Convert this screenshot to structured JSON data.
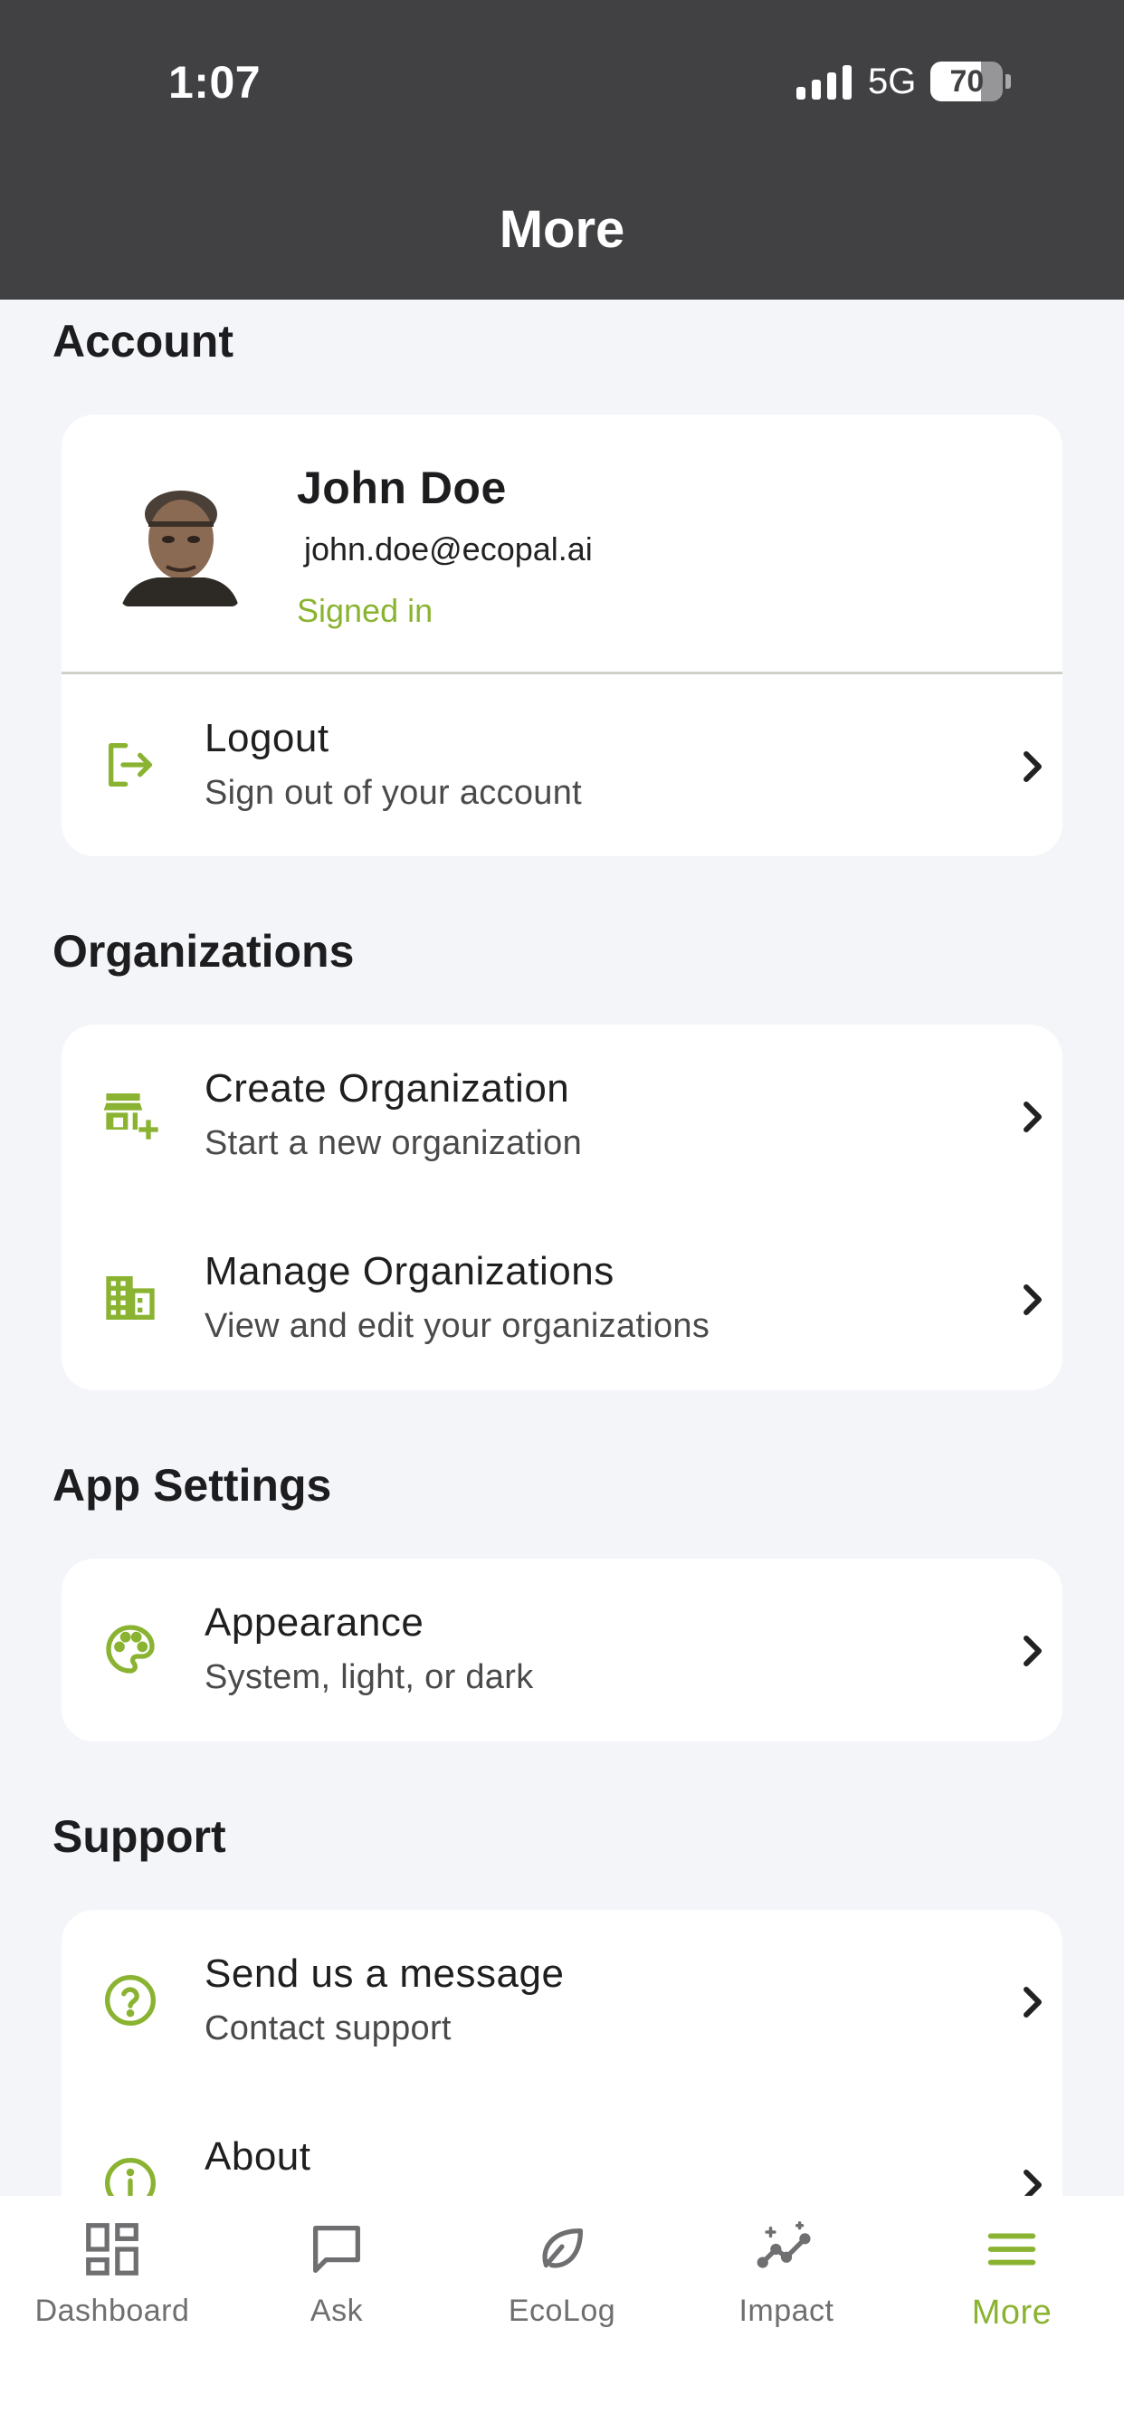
{
  "status_bar": {
    "time": "1:07",
    "network": "5G",
    "battery": "70"
  },
  "header": {
    "title": "More"
  },
  "colors": {
    "accent": "#8ab332",
    "header_bg": "#414144",
    "page_bg": "#f4f5f9"
  },
  "sections": {
    "account": {
      "title": "Account",
      "profile": {
        "name": "John Doe",
        "email": "john.doe@ecopal.ai",
        "status": "Signed in"
      },
      "logout": {
        "title": "Logout",
        "subtitle": "Sign out of your account",
        "icon": "logout-icon"
      }
    },
    "organizations": {
      "title": "Organizations",
      "create": {
        "title": "Create Organization",
        "subtitle": "Start a new organization",
        "icon": "store-plus-icon"
      },
      "manage": {
        "title": "Manage Organizations",
        "subtitle": "View and edit your organizations",
        "icon": "building-icon"
      }
    },
    "app_settings": {
      "title": "App Settings",
      "appearance": {
        "title": "Appearance",
        "subtitle": "System, light, or dark",
        "icon": "palette-icon"
      }
    },
    "support": {
      "title": "Support",
      "message": {
        "title": "Send us a message",
        "subtitle": "Contact support",
        "icon": "help-circle-icon"
      },
      "about": {
        "title": "About",
        "icon": "info-icon"
      }
    }
  },
  "tabbar": {
    "tabs": [
      {
        "label": "Dashboard",
        "icon": "dashboard-icon"
      },
      {
        "label": "Ask",
        "icon": "chat-icon"
      },
      {
        "label": "EcoLog",
        "icon": "leaf-icon"
      },
      {
        "label": "Impact",
        "icon": "sparkle-chart-icon"
      },
      {
        "label": "More",
        "icon": "menu-icon",
        "active": true
      }
    ]
  }
}
